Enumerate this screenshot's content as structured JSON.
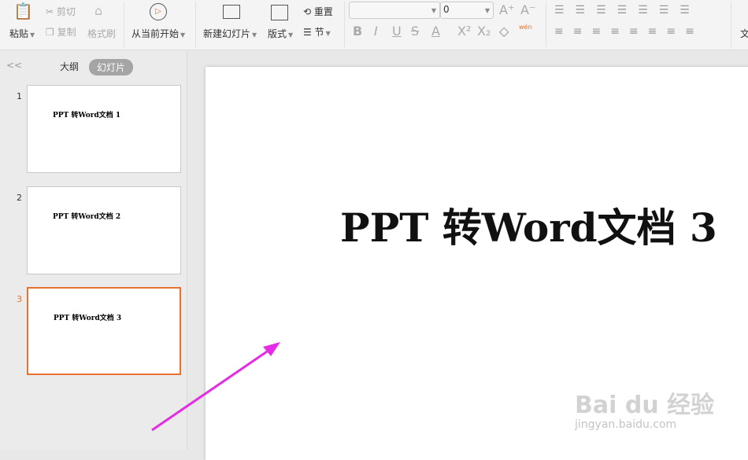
{
  "toolbar": {
    "paste": "粘贴",
    "cut": "剪切",
    "copy": "复制",
    "format_painter": "格式刷",
    "play_from_current": "从当前开始",
    "new_slide": "新建幻灯片",
    "layout": "版式",
    "reset": "重置",
    "section": "节",
    "font_name": "",
    "font_size": "0",
    "phonetic": "wén",
    "more": "文"
  },
  "panel": {
    "tab_outline": "大纲",
    "tab_slides": "幻灯片",
    "collapse": "<<"
  },
  "slides": [
    {
      "num": "1",
      "title": "PPT 转Word文档 1"
    },
    {
      "num": "2",
      "title": "PPT 转Word文档 2"
    },
    {
      "num": "3",
      "title": "PPT 转Word文档 3"
    }
  ],
  "main": {
    "title": "PPT 转Word文档 3"
  },
  "watermark": {
    "brand": "Bai du 经验",
    "url": "jingyan.baidu.com"
  },
  "colors": {
    "accent": "#e8712f",
    "arrow": "#e52be5"
  }
}
